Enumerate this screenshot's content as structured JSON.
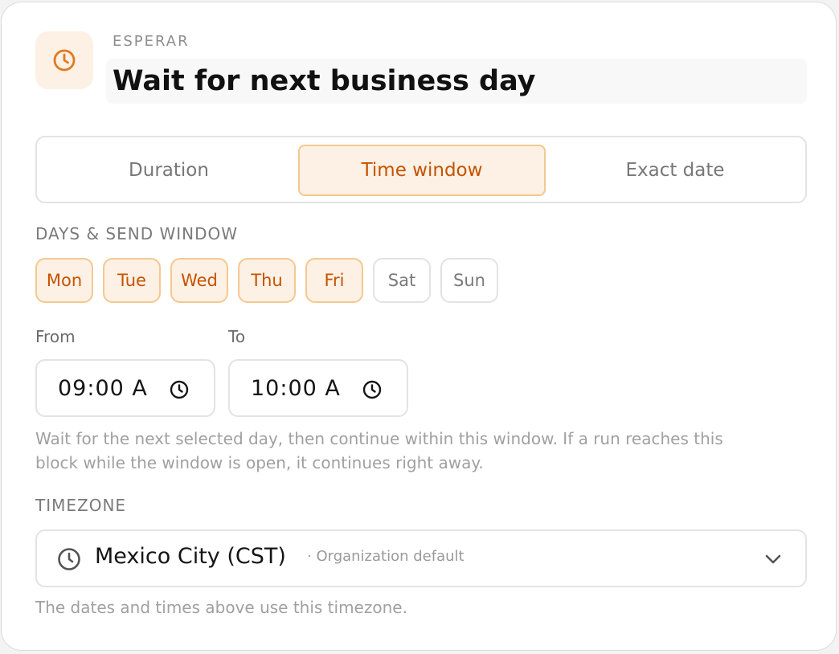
{
  "header": {
    "icon": "clock-icon",
    "eyebrow": "ESPERAR",
    "title": "Wait for next business day"
  },
  "mode_tabs": {
    "selected": "Time window",
    "items": [
      {
        "label": "Duration",
        "active": false
      },
      {
        "label": "Time window",
        "active": true
      },
      {
        "label": "Exact date",
        "active": false
      }
    ]
  },
  "days_section": {
    "label": "DAYS & SEND WINDOW",
    "days": [
      {
        "label": "Mon",
        "selected": true
      },
      {
        "label": "Tue",
        "selected": true
      },
      {
        "label": "Wed",
        "selected": true
      },
      {
        "label": "Thu",
        "selected": true
      },
      {
        "label": "Fri",
        "selected": true
      },
      {
        "label": "Sat",
        "selected": false
      },
      {
        "label": "Sun",
        "selected": false
      }
    ]
  },
  "window": {
    "from_label": "From",
    "from_value": "09:00 A",
    "to_label": "To",
    "to_value": "10:00 A",
    "help_line1": "Wait for the next selected day, then continue within this window. If a run reaches this",
    "help_line2": "block while the window is open, it continues right away."
  },
  "timezone": {
    "label": "TIMEZONE",
    "value": "Mexico City (CST)",
    "note": "· Organization default",
    "help": "The dates and times above use this timezone."
  },
  "colors": {
    "accent": "#c55300",
    "accent_bg": "#fdf0e4",
    "accent_border": "#f3c98f",
    "icon_orange": "#e07a20"
  }
}
